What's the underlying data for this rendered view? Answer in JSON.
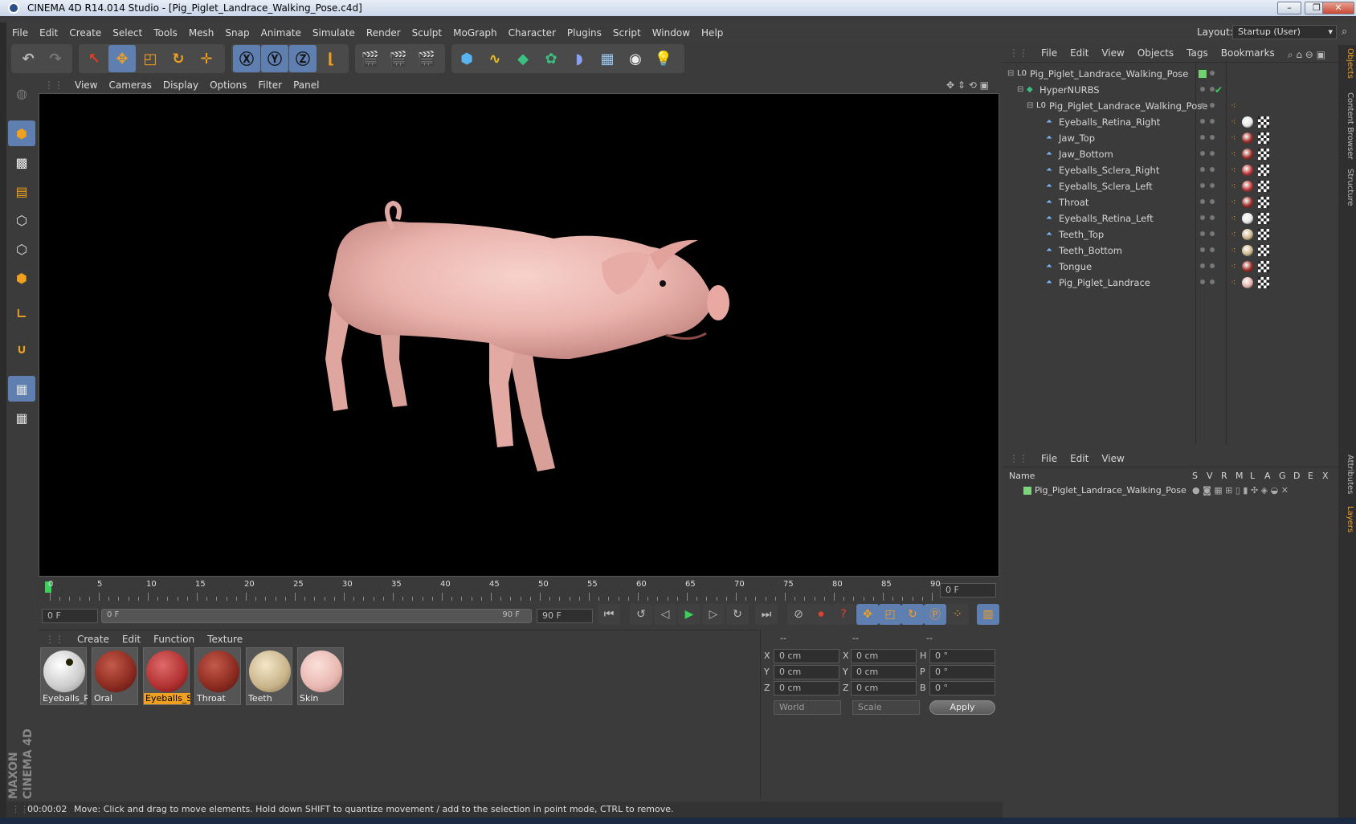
{
  "window": {
    "title": "CINEMA 4D R14.014 Studio - [Pig_Piglet_Landrace_Walking_Pose.c4d]",
    "controls": [
      "–",
      "❐",
      "✕"
    ]
  },
  "menu": [
    "File",
    "Edit",
    "Create",
    "Select",
    "Tools",
    "Mesh",
    "Snap",
    "Animate",
    "Simulate",
    "Render",
    "Sculpt",
    "MoGraph",
    "Character",
    "Plugins",
    "Script",
    "Window",
    "Help"
  ],
  "layout": {
    "label": "Layout:",
    "value": "Startup (User)"
  },
  "viewport": {
    "menu": [
      "View",
      "Cameras",
      "Display",
      "Options",
      "Filter",
      "Panel"
    ]
  },
  "timeline": {
    "ticks": [
      0,
      5,
      10,
      15,
      20,
      25,
      30,
      35,
      40,
      45,
      50,
      55,
      60,
      65,
      70,
      75,
      80,
      85,
      90
    ],
    "current_frame": "0 F"
  },
  "transport": {
    "start": "0 F",
    "range_start": "0 F",
    "range_end": "90 F",
    "end": "90 F"
  },
  "materials": {
    "menu": [
      "Create",
      "Edit",
      "Function",
      "Texture"
    ],
    "items": [
      {
        "label": "Eyeballs_Re",
        "color": "#f0f0f0"
      },
      {
        "label": "Oral",
        "color": "#8a2a20"
      },
      {
        "label": "Eyeballs_Sc",
        "color": "#b03030",
        "selected": true
      },
      {
        "label": "Throat",
        "color": "#8a2a20"
      },
      {
        "label": "Teeth",
        "color": "#c9b48a"
      },
      {
        "label": "Skin",
        "color": "#e8b8b0"
      }
    ]
  },
  "coordinates": {
    "headers": [
      "--",
      "--",
      "--"
    ],
    "rows": [
      {
        "a": "X",
        "av": "0 cm",
        "b": "X",
        "bv": "0 cm",
        "c": "H",
        "cv": "0 °"
      },
      {
        "a": "Y",
        "av": "0 cm",
        "b": "Y",
        "bv": "0 cm",
        "c": "P",
        "cv": "0 °"
      },
      {
        "a": "Z",
        "av": "0 cm",
        "b": "Z",
        "bv": "0 cm",
        "c": "B",
        "cv": "0 °"
      }
    ],
    "world": "World",
    "scale": "Scale",
    "apply": "Apply"
  },
  "objects": {
    "menu": [
      "File",
      "Edit",
      "View",
      "Objects",
      "Tags",
      "Bookmarks"
    ],
    "tree": [
      {
        "name": "Pig_Piglet_Landrace_Walking_Pose",
        "level": 0,
        "kind": "null",
        "status": "green"
      },
      {
        "name": "HyperNURBS",
        "level": 1,
        "kind": "nurbs",
        "status": "check"
      },
      {
        "name": "Pig_Piglet_Landrace_Walking_Pose",
        "level": 2,
        "kind": "null",
        "status": ""
      },
      {
        "name": "Eyeballs_Retina_Right",
        "level": 3,
        "kind": "poly",
        "tag": "#e8e8e8"
      },
      {
        "name": "Jaw_Top",
        "level": 3,
        "kind": "poly",
        "tag": "#9a2a22"
      },
      {
        "name": "Jaw_Bottom",
        "level": 3,
        "kind": "poly",
        "tag": "#9a2a22"
      },
      {
        "name": "Eyeballs_Sclera_Right",
        "level": 3,
        "kind": "poly",
        "tag": "#b83434"
      },
      {
        "name": "Eyeballs_Sclera_Left",
        "level": 3,
        "kind": "poly",
        "tag": "#b83434"
      },
      {
        "name": "Throat",
        "level": 3,
        "kind": "poly",
        "tag": "#9a2a22"
      },
      {
        "name": "Eyeballs_Retina_Left",
        "level": 3,
        "kind": "poly",
        "tag": "#e8e8e8"
      },
      {
        "name": "Teeth_Top",
        "level": 3,
        "kind": "poly",
        "tag": "#c9b48a"
      },
      {
        "name": "Teeth_Bottom",
        "level": 3,
        "kind": "poly",
        "tag": "#c9b48a"
      },
      {
        "name": "Tongue",
        "level": 3,
        "kind": "poly",
        "tag": "#9a2a22"
      },
      {
        "name": "Pig_Piglet_Landrace",
        "level": 3,
        "kind": "poly",
        "tag": "#e3b2aa"
      }
    ]
  },
  "layers": {
    "menu": [
      "File",
      "Edit",
      "View"
    ],
    "columns": [
      "Name",
      "S",
      "V",
      "R",
      "M",
      "L",
      "A",
      "G",
      "D",
      "E",
      "X"
    ],
    "rows": [
      {
        "name": "Pig_Piglet_Landrace_Walking_Pose",
        "color": "#7ed37e"
      }
    ]
  },
  "side_tabs": [
    "Objects",
    "Content Browser",
    "Structure",
    "Attributes",
    "Layers"
  ],
  "status": {
    "time": "00:00:02",
    "message": "Move: Click and drag to move elements. Hold down SHIFT to quantize movement / add to the selection in point mode, CTRL to remove."
  },
  "branding": "MAXON CINEMA 4D",
  "colors": {
    "accent": "#5f7fb0",
    "selection": "#f0a020",
    "viewport_bg": "#000000"
  }
}
